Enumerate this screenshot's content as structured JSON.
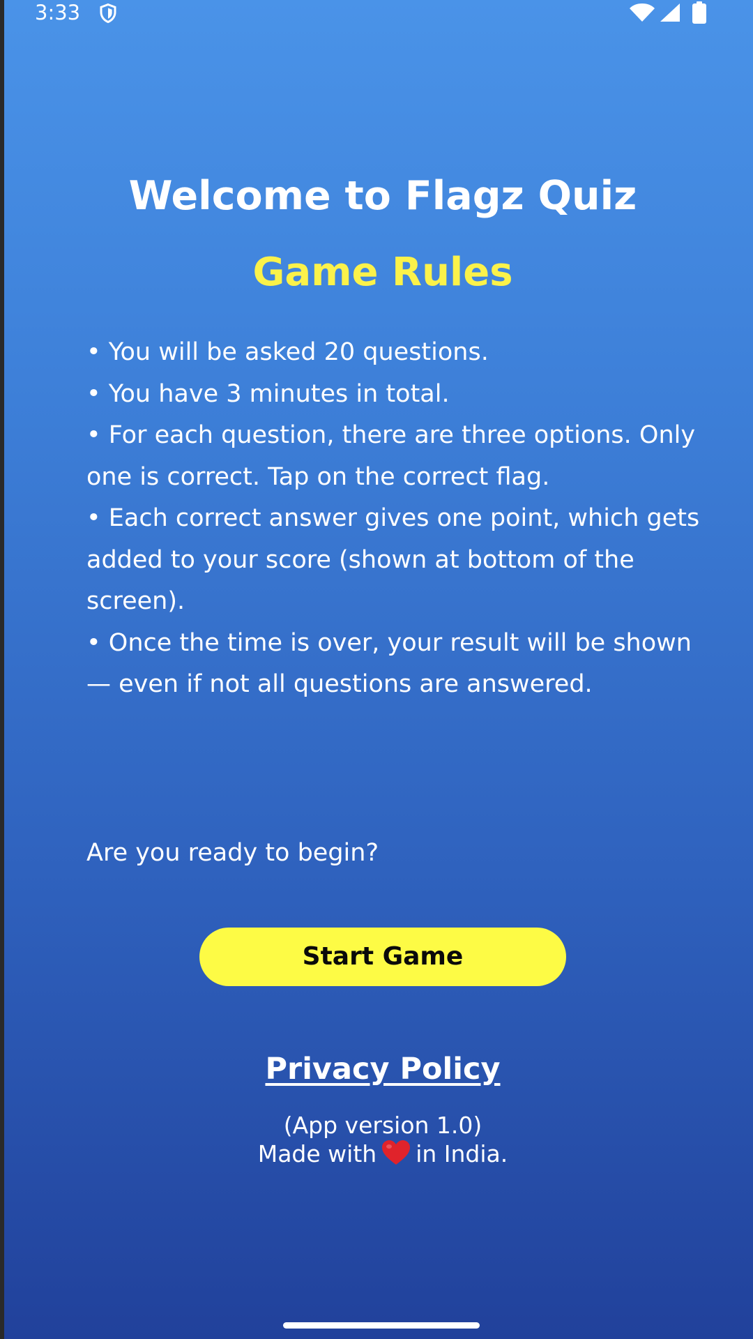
{
  "status_bar": {
    "time": "3:33",
    "icons": [
      "shield-icon",
      "wifi-icon",
      "signal-icon",
      "battery-icon"
    ]
  },
  "welcome": {
    "title": "Welcome to Flagz Quiz",
    "subtitle": "Game Rules"
  },
  "rules": [
    "• You will be asked 20 questions.",
    "• You have 3 minutes in total.",
    "• For each question, there are three options. Only one is correct. Tap on the correct flag.",
    "• Each correct answer gives one point, which gets added to your score (shown at bottom of the screen).",
    "• Once the time is over, your result will be shown — even if not all questions are answered."
  ],
  "prompt": "Are you ready to begin?",
  "start_button": "Start Game",
  "privacy_link": "Privacy Policy",
  "footer": {
    "version": "(App version 1.0)",
    "made_with_prefix": "Made with",
    "made_with_suffix": "in India.",
    "heart_icon": "heart-icon"
  },
  "colors": {
    "gradient_top": "#4a93e8",
    "gradient_bottom": "#21419b",
    "accent_yellow": "#fbf24a",
    "button_yellow": "#fdfb45",
    "text_white": "#ffffff",
    "heart_red": "#e0232b"
  }
}
